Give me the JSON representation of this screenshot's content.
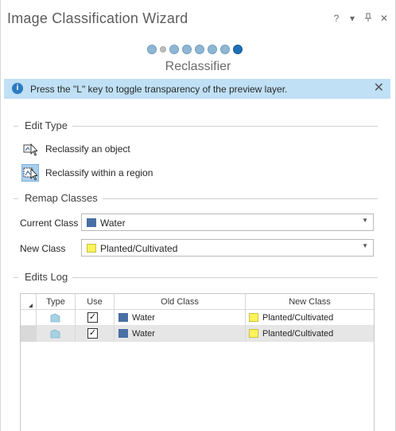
{
  "window": {
    "title": "Image Classification Wizard",
    "controls": {
      "help": "?",
      "menu": "▾",
      "pin": "⊥",
      "close": "✕"
    }
  },
  "wizard": {
    "step_title": "Reclassifier",
    "steps_total": 8,
    "current_step": 8
  },
  "infobar": {
    "icon": "info-icon",
    "message": "Press the \"L\" key to toggle transparency of the preview layer.",
    "close": "✕"
  },
  "edit_type": {
    "heading": "Edit Type",
    "tools": [
      {
        "label": "Reclassify an object",
        "icon": "reclassify-object-icon",
        "selected": false
      },
      {
        "label": "Reclassify within a region",
        "icon": "reclassify-region-icon",
        "selected": true
      }
    ]
  },
  "remap": {
    "heading": "Remap Classes",
    "current_class": {
      "label": "Current Class",
      "value": "Water",
      "color": "#4a6fa5"
    },
    "new_class": {
      "label": "New Class",
      "value": "Planted/Cultivated",
      "color": "#fdf35a"
    }
  },
  "edits_log": {
    "heading": "Edits Log",
    "columns": [
      "Type",
      "Use",
      "Old Class",
      "New Class"
    ],
    "rows": [
      {
        "use": true,
        "check": "✓",
        "old_class": "Water",
        "old_color": "#4a6fa5",
        "new_class": "Planted/Cultivated",
        "new_color": "#fdf35a",
        "selected": false
      },
      {
        "use": true,
        "check": "✓",
        "old_class": "Water",
        "old_color": "#4a6fa5",
        "new_class": "Planted/Cultivated",
        "new_color": "#fdf35a",
        "selected": true
      }
    ]
  },
  "colors": {
    "accent": "#1f6fb5",
    "info_bg": "#bfe0f5",
    "water": "#4a6fa5",
    "planted": "#fdf35a"
  }
}
